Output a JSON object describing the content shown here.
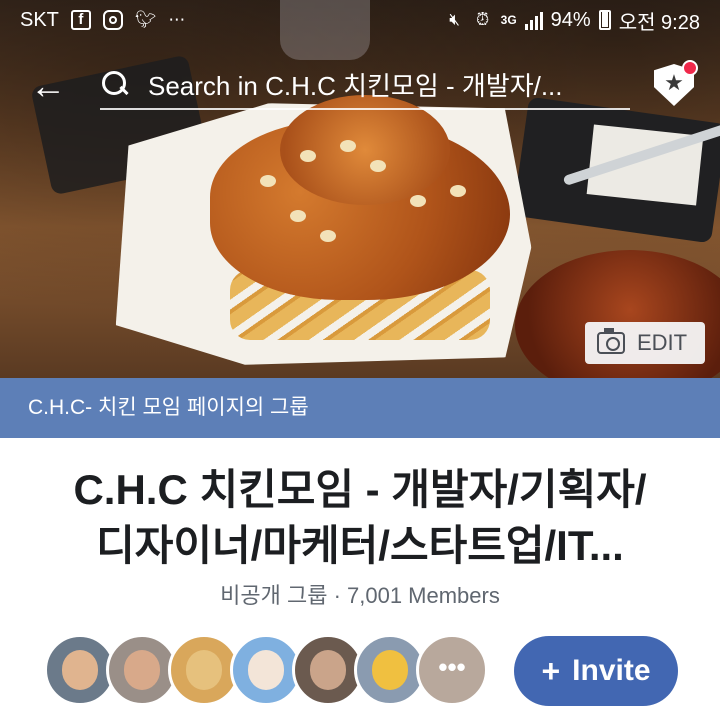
{
  "status_bar": {
    "carrier": "SKT",
    "left_icons": [
      "facebook-icon",
      "instagram-icon",
      "twitter-icon",
      "more-dots-icon"
    ],
    "right_icons": [
      "mute-icon",
      "alarm-icon",
      "3g-icon",
      "signal-icon",
      "battery-icon"
    ],
    "network": "3G",
    "battery": "94%",
    "time": "오전 9:28"
  },
  "header": {
    "search_placeholder": "Search in C.H.C 치킨모임 - 개발자/...",
    "back_icon": "back-arrow-icon",
    "shield_icon": "admin-shield-icon",
    "has_notification": true
  },
  "cover": {
    "edit_label": "EDIT"
  },
  "banner": {
    "text": "C.H.C- 치킨 모임 페이지의 그룹"
  },
  "group": {
    "title_line1": "C.H.C 치킨모임 - 개발자/기획자/",
    "title_line2": "디자이너/마케터/스타트업/IT...",
    "meta": "비공개 그룹 · 7,001 Members"
  },
  "members": {
    "more_label": "•••",
    "avatar_colors": [
      "#6b7a8a",
      "#9a8f88",
      "#d9a75b",
      "#7fb0e0",
      "#6b5a4f",
      "#8a9bb0",
      "#d8c2b3"
    ]
  },
  "actions": {
    "invite_label": "Invite"
  },
  "colors": {
    "banner": "#5d7fb7",
    "invite_button": "#4267b2",
    "notification_dot": "#f0284a"
  }
}
